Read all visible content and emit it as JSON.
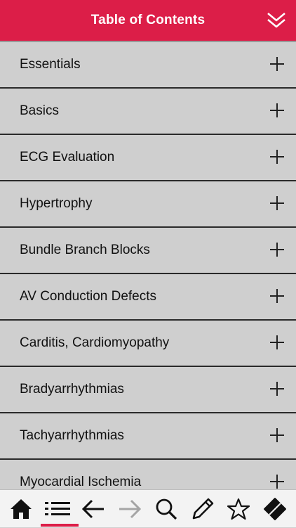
{
  "header": {
    "title": "Table of Contents",
    "collapse_icon": "double-chevron-down-icon"
  },
  "toc": {
    "items": [
      {
        "label": "Essentials"
      },
      {
        "label": "Basics"
      },
      {
        "label": "ECG Evaluation"
      },
      {
        "label": "Hypertrophy"
      },
      {
        "label": "Bundle Branch Blocks"
      },
      {
        "label": "AV Conduction Defects"
      },
      {
        "label": "Carditis, Cardiomyopathy"
      },
      {
        "label": "Bradyarrhythmias"
      },
      {
        "label": "Tachyarrhythmias"
      },
      {
        "label": "Myocardial Ischemia"
      }
    ],
    "expand_icon": "plus-icon"
  },
  "toolbar": {
    "icons": [
      "home-icon",
      "list-icon",
      "back-arrow-icon",
      "forward-arrow-icon",
      "search-icon",
      "pencil-icon",
      "star-icon",
      "bookmark-icon"
    ],
    "active": "list-icon"
  },
  "colors": {
    "accent": "#dc1e48",
    "list_bg": "#cfcfcf",
    "toolbar_bg": "#f3f3f3"
  }
}
